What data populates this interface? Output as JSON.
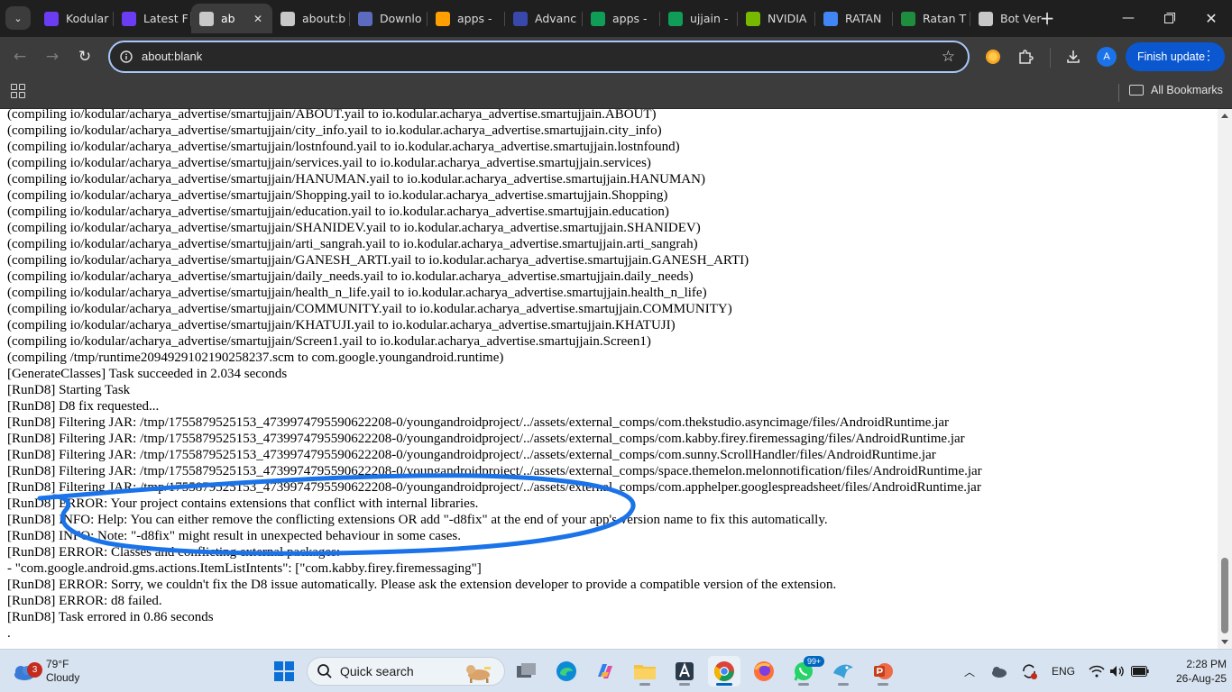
{
  "browser": {
    "tabs": [
      {
        "label": "Kodular",
        "icon": "kodular-k-icon",
        "color": "#6a3df2"
      },
      {
        "label": "Latest F",
        "icon": "kodular-k-icon",
        "color": "#6a3df2"
      },
      {
        "label": "ab",
        "icon": "globe-icon",
        "color": "#c8c8c8",
        "active": true
      },
      {
        "label": "about:b",
        "icon": "globe-icon",
        "color": "#c8c8c8"
      },
      {
        "label": "Downlo",
        "icon": "flow-icon",
        "color": "#5c6bc0"
      },
      {
        "label": "apps -",
        "icon": "firebase-icon",
        "color": "#ffa000"
      },
      {
        "label": "Advanc",
        "icon": "rainbow-icon",
        "color": "#3949ab"
      },
      {
        "label": "apps -",
        "icon": "sheets-icon",
        "color": "#0f9d58"
      },
      {
        "label": "ujjain -",
        "icon": "sheets-icon",
        "color": "#0f9d58"
      },
      {
        "label": "NVIDIA",
        "icon": "nvidia-icon",
        "color": "#76b900"
      },
      {
        "label": "RATAN",
        "icon": "google-icon",
        "color": "#4285f4"
      },
      {
        "label": "Ratan T",
        "icon": "gem-icon",
        "color": "#1e8e3e"
      },
      {
        "label": "Bot Ver",
        "icon": "globe-icon",
        "color": "#c8c8c8"
      }
    ],
    "address": "about:blank",
    "update_label": "Finish update",
    "profile_initial": "A",
    "all_bookmarks_label": "All Bookmarks"
  },
  "log_lines": [
    "(compiling io/kodular/acharya_advertise/smartujjain/ABOUT.yail to io.kodular.acharya_advertise.smartujjain.ABOUT)",
    "(compiling io/kodular/acharya_advertise/smartujjain/city_info.yail to io.kodular.acharya_advertise.smartujjain.city_info)",
    "(compiling io/kodular/acharya_advertise/smartujjain/lostnfound.yail to io.kodular.acharya_advertise.smartujjain.lostnfound)",
    "(compiling io/kodular/acharya_advertise/smartujjain/services.yail to io.kodular.acharya_advertise.smartujjain.services)",
    "(compiling io/kodular/acharya_advertise/smartujjain/HANUMAN.yail to io.kodular.acharya_advertise.smartujjain.HANUMAN)",
    "(compiling io/kodular/acharya_advertise/smartujjain/Shopping.yail to io.kodular.acharya_advertise.smartujjain.Shopping)",
    "(compiling io/kodular/acharya_advertise/smartujjain/education.yail to io.kodular.acharya_advertise.smartujjain.education)",
    "(compiling io/kodular/acharya_advertise/smartujjain/SHANIDEV.yail to io.kodular.acharya_advertise.smartujjain.SHANIDEV)",
    "(compiling io/kodular/acharya_advertise/smartujjain/arti_sangrah.yail to io.kodular.acharya_advertise.smartujjain.arti_sangrah)",
    "(compiling io/kodular/acharya_advertise/smartujjain/GANESH_ARTI.yail to io.kodular.acharya_advertise.smartujjain.GANESH_ARTI)",
    "(compiling io/kodular/acharya_advertise/smartujjain/daily_needs.yail to io.kodular.acharya_advertise.smartujjain.daily_needs)",
    "(compiling io/kodular/acharya_advertise/smartujjain/health_n_life.yail to io.kodular.acharya_advertise.smartujjain.health_n_life)",
    "(compiling io/kodular/acharya_advertise/smartujjain/COMMUNITY.yail to io.kodular.acharya_advertise.smartujjain.COMMUNITY)",
    "(compiling io/kodular/acharya_advertise/smartujjain/KHATUJI.yail to io.kodular.acharya_advertise.smartujjain.KHATUJI)",
    "(compiling io/kodular/acharya_advertise/smartujjain/Screen1.yail to io.kodular.acharya_advertise.smartujjain.Screen1)",
    "(compiling /tmp/runtime2094929102190258237.scm to com.google.youngandroid.runtime)",
    "[GenerateClasses] Task succeeded in 2.034 seconds",
    "[RunD8] Starting Task",
    "[RunD8] D8 fix requested...",
    "[RunD8] Filtering JAR: /tmp/1755879525153_4739974795590622208-0/youngandroidproject/../assets/external_comps/com.thekstudio.asyncimage/files/AndroidRuntime.jar",
    "[RunD8] Filtering JAR: /tmp/1755879525153_4739974795590622208-0/youngandroidproject/../assets/external_comps/com.kabby.firey.firemessaging/files/AndroidRuntime.jar",
    "[RunD8] Filtering JAR: /tmp/1755879525153_4739974795590622208-0/youngandroidproject/../assets/external_comps/com.sunny.ScrollHandler/files/AndroidRuntime.jar",
    "[RunD8] Filtering JAR: /tmp/1755879525153_4739974795590622208-0/youngandroidproject/../assets/external_comps/space.themelon.melonnotification/files/AndroidRuntime.jar",
    "[RunD8] Filtering JAR: /tmp/1755879525153_4739974795590622208-0/youngandroidproject/../assets/external_comps/com.apphelper.googlespreadsheet/files/AndroidRuntime.jar",
    "[RunD8] ERROR: Your project contains extensions that conflict with internal libraries.",
    "[RunD8] INFO: Help: You can either remove the conflicting extensions OR add \"-d8fix\" at the end of your app's version name to fix this automatically.",
    "[RunD8] INFO: Note: \"-d8fix\" might result in unexpected behaviour in some cases.",
    "[RunD8] ERROR: Classes and conflicting external packages:",
    "- \"com.google.android.gms.actions.ItemListIntents\": [\"com.kabby.firey.firemessaging\"]",
    "[RunD8] ERROR: Sorry, we couldn't fix the D8 issue automatically. Please ask the extension developer to provide a compatible version of the extension.",
    "[RunD8] ERROR: d8 failed.",
    "[RunD8] Task errored in 0.86 seconds",
    "."
  ],
  "annotation_color": "#1a73e8",
  "taskbar": {
    "weather_temp": "79°F",
    "weather_condition": "Cloudy",
    "weather_badge": "3",
    "search_label": "Quick search",
    "whatsapp_badge": "99+",
    "language": "ENG",
    "time": "2:28 PM",
    "date": "26-Aug-25"
  }
}
